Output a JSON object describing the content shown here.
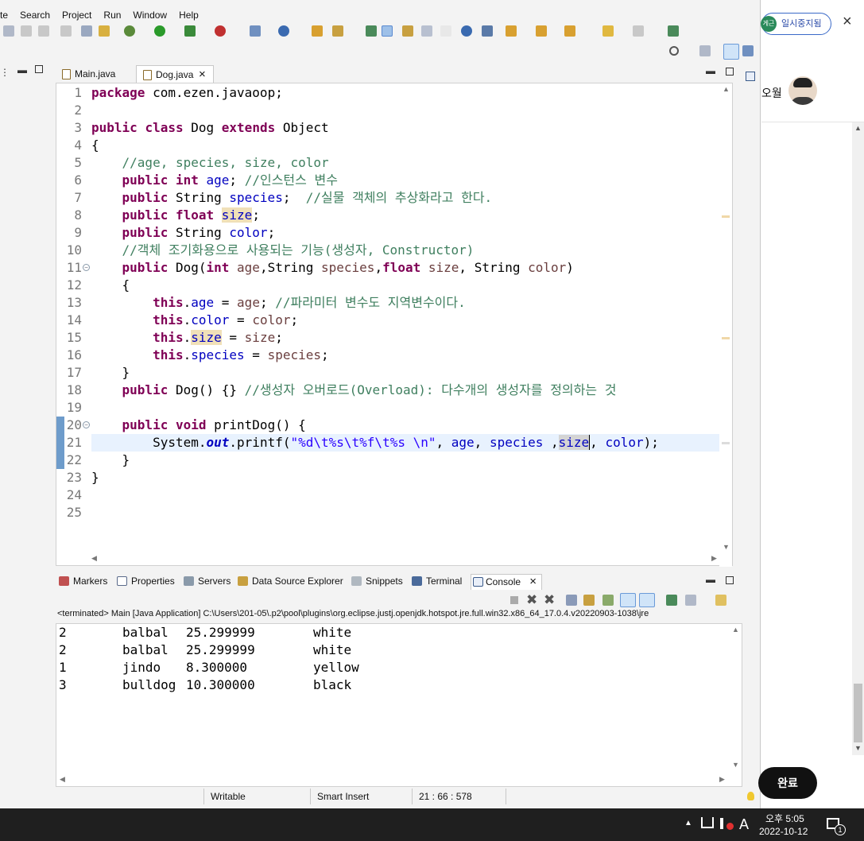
{
  "menu": [
    "te",
    "Search",
    "Project",
    "Run",
    "Window",
    "Help"
  ],
  "editor_tabs": [
    {
      "label": "Main.java",
      "active": false
    },
    {
      "label": "Dog.java",
      "active": true,
      "close": "×"
    }
  ],
  "line_numbers": [
    "1",
    "2",
    "3",
    "4",
    "5",
    "6",
    "7",
    "8",
    "9",
    "10",
    "11",
    "12",
    "13",
    "14",
    "15",
    "16",
    "17",
    "18",
    "19",
    "20",
    "21",
    "22",
    "23",
    "24",
    "25"
  ],
  "code": {
    "l1": {
      "kw": "package",
      "rest": " com.ezen.javaoop;"
    },
    "l3": {
      "kw1": "public",
      "kw2": "class",
      "name": " Dog ",
      "kw3": "extends",
      "rest": " Object"
    },
    "l4": "{",
    "l5": "//age, species, size, color",
    "l6": {
      "kw1": "public",
      "kw2": "int",
      "fld": "age",
      "semi": ";",
      "cm": "//인스턴스 변수"
    },
    "l7": {
      "kw1": "public",
      "type": " String ",
      "fld": "species",
      "semi": ";",
      "cm": "//실물 객체의 추상화라고 한다."
    },
    "l8": {
      "kw1": "public",
      "kw2": "float",
      "fld": "size",
      "semi": ";"
    },
    "l9": {
      "kw1": "public",
      "type": " String ",
      "fld": "color",
      "semi": ";"
    },
    "l10": "//객체 조기화용으로 사용되는 기능(생성자, Constructor)",
    "l11": {
      "kw1": "public",
      "sig1": " Dog(",
      "kw2": "int",
      "p1": " age",
      "c1": ",String ",
      "p2": "species",
      "c2": ",",
      "kw3": "float",
      "p3": " size",
      "c3": ", String ",
      "p4": "color",
      "end": ")"
    },
    "l12": "{",
    "l13": {
      "kw": "this",
      "dot": ".",
      "fld": "age",
      "eq": " = ",
      "par": "age",
      "semi": "; ",
      "cm": "//파라미터 변수도 지역변수이다."
    },
    "l14": {
      "kw": "this",
      "dot": ".",
      "fld": "color",
      "eq": " = ",
      "par": "color",
      "semi": ";"
    },
    "l15": {
      "kw": "this",
      "dot": ".",
      "fld": "size",
      "eq": " = ",
      "par": "size",
      "semi": ";"
    },
    "l16": {
      "kw": "this",
      "dot": ".",
      "fld": "species",
      "eq": " = ",
      "par": "species",
      "semi": ";"
    },
    "l17": "}",
    "l18": {
      "kw": "public",
      "rest": " Dog() {} ",
      "cm": "//생성자 오버로드(Overload): 다수개의 생성자를 정의하는 것"
    },
    "l20": {
      "kw1": "public",
      "kw2": "void",
      "rest": " printDog() {"
    },
    "l21": {
      "a": "System.",
      "st": "out",
      "b": ".printf(",
      "str": "\"%d\\t%s\\t%f\\t%s \\n\"",
      "c": ", ",
      "f1": "age",
      "d": ", ",
      "f2": "species",
      "e": " ,",
      "f3": "size",
      "f": ", ",
      "f4": "color",
      "g": ");"
    },
    "l22": "}",
    "l23": "}"
  },
  "views": [
    "Markers",
    "Properties",
    "Servers",
    "Data Source Explorer",
    "Snippets",
    "Terminal",
    "Console"
  ],
  "console": {
    "terminated": "<terminated> Main [Java Application] C:\\Users\\201-05\\.p2\\pool\\plugins\\org.eclipse.justj.openjdk.hotspot.jre.full.win32.x86_64_17.0.4.v20220903-1038\\jre",
    "rows": [
      [
        "2",
        "balbal",
        "25.299999",
        "white"
      ],
      [
        "2",
        "balbal",
        "25.299999",
        "white"
      ],
      [
        "1",
        "jindo",
        "8.300000",
        "yellow"
      ],
      [
        "3",
        "bulldog",
        "10.300000",
        "black"
      ]
    ]
  },
  "status": {
    "writable": "Writable",
    "insert": "Smart Insert",
    "position": "21 : 66 : 578"
  },
  "right_panel": {
    "badge": "일시중지됨",
    "badge_prefix": "게근",
    "name": "오월",
    "done": "완료"
  },
  "taskbar": {
    "ampm_time": "오후 5:05",
    "date": "2022-10-12",
    "ime": "A",
    "notif_count": "1"
  },
  "colors": {
    "keyword": "#7f0055",
    "field": "#0000c0",
    "comment": "#3f7f5f",
    "string": "#2a00ff",
    "param": "#6a3e3e"
  }
}
